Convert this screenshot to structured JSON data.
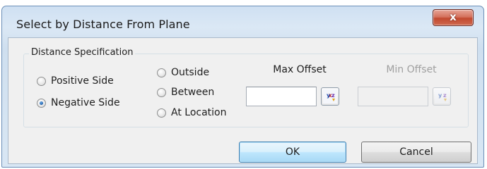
{
  "dialog": {
    "title": "Select by Distance From Plane",
    "close_label": "x"
  },
  "distance_spec": {
    "legend": "Distance Specification",
    "side_options": [
      {
        "label": "Positive Side",
        "checked": false
      },
      {
        "label": "Negative Side",
        "checked": true
      }
    ],
    "location_options": [
      {
        "label": "Outside",
        "checked": false
      },
      {
        "label": "Between",
        "checked": false
      },
      {
        "label": "At Location",
        "checked": false
      }
    ],
    "max_offset": {
      "label": "Max Offset",
      "value": "",
      "enabled": true,
      "picker_icon": "xyz-picker-icon"
    },
    "min_offset": {
      "label": "Min Offset",
      "value": "",
      "enabled": false,
      "picker_icon": "xyz-picker-icon"
    }
  },
  "buttons": {
    "ok_label": "OK",
    "cancel_label": "Cancel"
  },
  "colors": {
    "title_bar": "#dbe8f5",
    "close_button": "#c9503a",
    "default_button": "#bee6fd"
  }
}
